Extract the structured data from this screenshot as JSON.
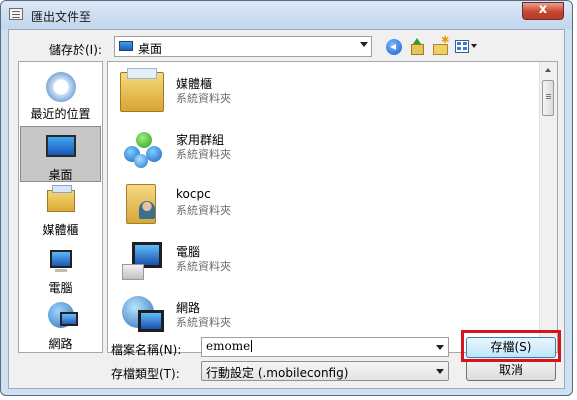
{
  "window": {
    "title": "匯出文件至",
    "close_symbol": "x"
  },
  "savein": {
    "label": "儲存於(I):",
    "value": "桌面"
  },
  "toolbar": {
    "icons": [
      "back-icon",
      "up-folder-icon",
      "new-folder-icon",
      "views-icon"
    ]
  },
  "places": [
    {
      "label": "最近的位置",
      "icon": "recent-places-icon",
      "selected": false
    },
    {
      "label": "桌面",
      "icon": "desktop-icon",
      "selected": true
    },
    {
      "label": "媒體櫃",
      "icon": "libraries-icon",
      "selected": false
    },
    {
      "label": "電腦",
      "icon": "computer-icon",
      "selected": false
    },
    {
      "label": "網路",
      "icon": "network-icon",
      "selected": false
    }
  ],
  "files": [
    {
      "name": "媒體櫃",
      "type": "系統資料夾",
      "icon": "libraries-icon"
    },
    {
      "name": "家用群組",
      "type": "系統資料夾",
      "icon": "homegroup-icon"
    },
    {
      "name": "kocpc",
      "type": "系統資料夾",
      "icon": "user-folder-icon"
    },
    {
      "name": "電腦",
      "type": "系統資料夾",
      "icon": "computer-icon"
    },
    {
      "name": "網路",
      "type": "系統資料夾",
      "icon": "network-icon"
    }
  ],
  "filename": {
    "label": "檔案名稱(N):",
    "value": "emome"
  },
  "filetype": {
    "label": "存檔類型(T):",
    "value": "行動設定 (.mobileconfig)"
  },
  "buttons": {
    "save": "存檔(S)",
    "cancel": "取消"
  },
  "colors": {
    "highlight": "#d7141a",
    "window_frame": "#cfe0f3"
  }
}
